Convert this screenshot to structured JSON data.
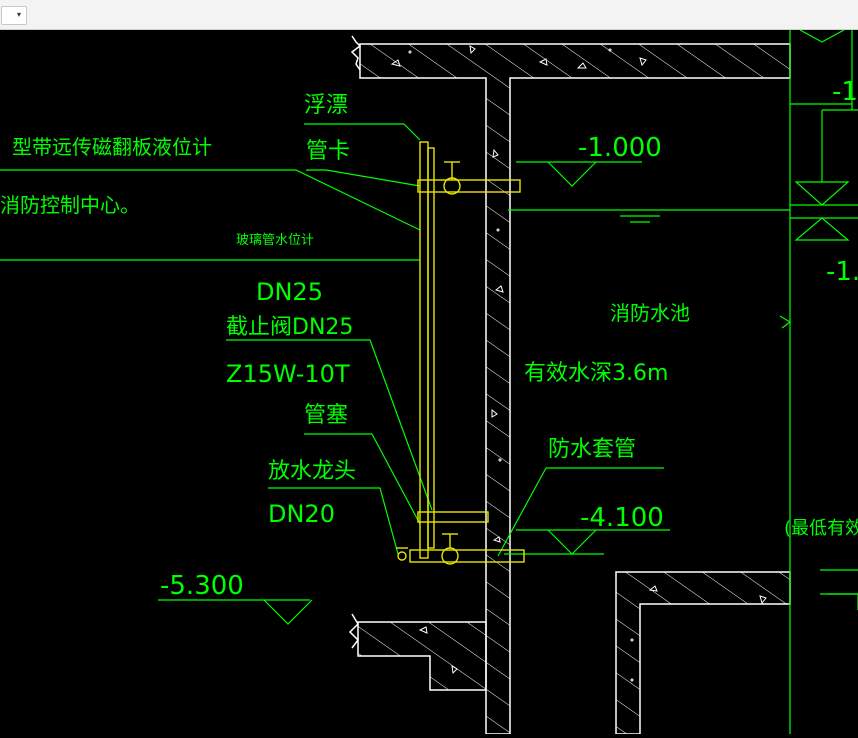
{
  "toolbar": {
    "dropdown_arrow": "▾"
  },
  "colors": {
    "background": "#000000",
    "line_green": "#00ff00",
    "pipe_yellow": "#e6e600",
    "structure_white": "#ffffff",
    "text_green": "#00ff00"
  },
  "labels": {
    "floating_ball": "浮漂",
    "pipe_clamp": "管卡",
    "magnetic_gauge": "型带远传磁翻板液位计",
    "fire_control_center": "消防控制中心。",
    "glass_gauge": "玻璃管水位计",
    "dn25_a": "DN25",
    "stop_valve_dn25": "截止阀DN25",
    "valve_model": "Z15W-10T",
    "pipe_plug": "管塞",
    "drain_tap": "放水龙头",
    "dn20": "DN20",
    "fire_pool": "消防水池",
    "effective_depth": "有效水深3.6m",
    "waterproof_sleeve": "防水套管",
    "min_effective": "(最低有效水",
    "level_top_right": "-1",
    "level_right_mid": "-1."
  },
  "levels": {
    "top": "-1.000",
    "bottom_water": "-4.100",
    "floor": "-5.300"
  }
}
